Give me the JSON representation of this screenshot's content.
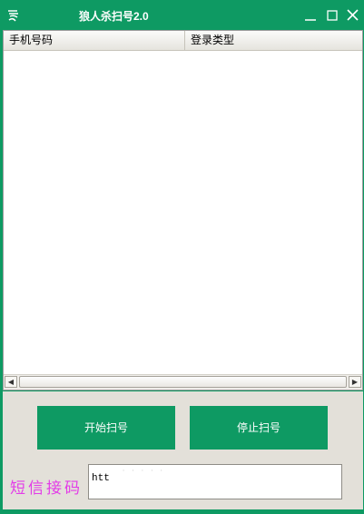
{
  "window": {
    "title": "狼人杀扫号2.0",
    "colors": {
      "accent": "#0e9a63",
      "panel": "#e3e0d9",
      "label": "#e33ce8"
    }
  },
  "list": {
    "columns": [
      "手机号码",
      "登录类型"
    ],
    "rows": []
  },
  "buttons": {
    "start_label": "开始扫号",
    "stop_label": "停止扫号"
  },
  "sms": {
    "label": "短信接码",
    "value": "htt",
    "faint_text": "· · · · ·"
  },
  "icons": [
    "app-logo-icon",
    "minimize-icon",
    "maximize-icon",
    "close-icon",
    "scroll-left-arrow-icon",
    "scroll-right-arrow-icon"
  ]
}
